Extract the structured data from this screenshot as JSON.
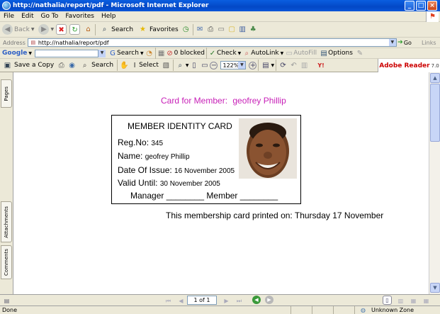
{
  "window": {
    "title": "http://nathalia/report/pdf - Microsoft Internet Explorer"
  },
  "menu": {
    "items": [
      "File",
      "Edit",
      "Go To",
      "Favorites",
      "Help"
    ]
  },
  "toolbar": {
    "back": "Back",
    "search": "Search",
    "favorites": "Favorites"
  },
  "address": {
    "label": "Address",
    "url": "http://nathalia/report/pdf",
    "go": "Go",
    "links": "Links"
  },
  "google": {
    "brand": "Google",
    "search": "Search",
    "blocked": "0 blocked",
    "check": "Check",
    "autolink": "AutoLink",
    "autofill": "AutoFill",
    "options": "Options"
  },
  "pdf_toolbar": {
    "save_copy": "Save a Copy",
    "search": "Search",
    "select": "Select",
    "zoom": "122%",
    "brand": "Adobe Reader",
    "version": "7.0"
  },
  "side_tabs": {
    "pages": "Pages",
    "attachments": "Attachments",
    "comments": "Comments"
  },
  "document": {
    "heading_label": "Card for Member:",
    "heading_name": "geofrey Phillip",
    "card_title": "MEMBER IDENTITY CARD",
    "reg_label": "Reg.No:",
    "reg_value": "345",
    "name_label": "Name:",
    "name_value": "geofrey Phillip",
    "issue_label": "Date Of Issue:",
    "issue_value": "16 November 2005",
    "valid_label": "Valid Until:",
    "valid_value": "30 November 2005",
    "signatures": "Manager ________   Member ________",
    "printed_label": "This membership card printed on:",
    "printed_value": "Thursday 17 November"
  },
  "nav": {
    "page": "1 of 1"
  },
  "status": {
    "left": "Done",
    "zone": "Unknown Zone"
  },
  "colors": {
    "title_bar": "#0348c6",
    "heading": "#c71fb7"
  }
}
